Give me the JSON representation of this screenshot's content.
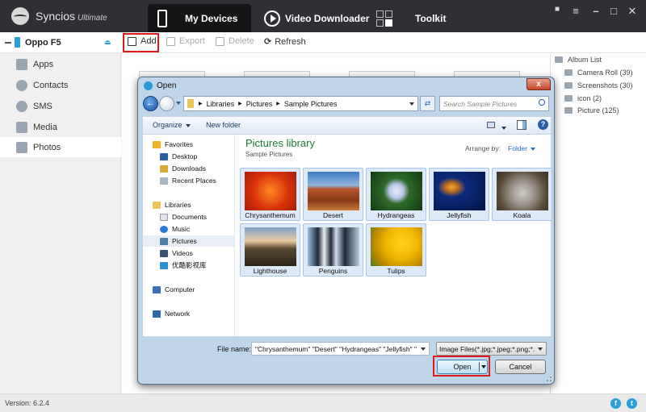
{
  "app": {
    "brand": "Syncios",
    "edition": "Ultimate",
    "nav_tabs": [
      {
        "label": "My Devices",
        "icon": "phone-icon",
        "active": true
      },
      {
        "label": "Video Downloader",
        "icon": "play-circle-icon",
        "active": false
      },
      {
        "label": "Toolkit",
        "icon": "grid-icon",
        "active": false
      }
    ],
    "window_controls": [
      "feedback-icon",
      "menu-icon",
      "minimize-icon",
      "maximize-icon",
      "close-icon"
    ]
  },
  "toolbar": {
    "device_name": "Oppo F5",
    "buttons": [
      {
        "label": "Add",
        "enabled": true,
        "highlighted": true
      },
      {
        "label": "Export",
        "enabled": false
      },
      {
        "label": "Delete",
        "enabled": false
      },
      {
        "label": "Refresh",
        "enabled": true
      }
    ]
  },
  "sidebar": {
    "items": [
      {
        "label": "Apps",
        "icon": "apps-icon"
      },
      {
        "label": "Contacts",
        "icon": "contacts-icon"
      },
      {
        "label": "SMS",
        "icon": "sms-icon"
      },
      {
        "label": "Media",
        "icon": "media-icon"
      },
      {
        "label": "Photos",
        "icon": "photos-icon",
        "active": true
      }
    ]
  },
  "albums": {
    "header": "Album List",
    "items": [
      {
        "label": "Camera Roll (39)"
      },
      {
        "label": "Screenshots (30)"
      },
      {
        "label": "icon (2)"
      },
      {
        "label": "Picture (125)"
      }
    ]
  },
  "footer": {
    "version": "Version: 6.2.4",
    "social": [
      "f",
      "t"
    ]
  },
  "dialog": {
    "title": "Open",
    "close": "x",
    "breadcrumbs": [
      "Libraries",
      "Pictures",
      "Sample Pictures"
    ],
    "search_placeholder": "Search Sample Pictures",
    "organize": "Organize",
    "new_folder": "New folder",
    "tree": {
      "favorites_header": "Favorites",
      "favorites": [
        "Desktop",
        "Downloads",
        "Recent Places"
      ],
      "libraries_header": "Libraries",
      "libraries": [
        "Documents",
        "Music",
        "Pictures",
        "Videos",
        "优酷影视库"
      ],
      "selected": "Pictures",
      "computer": "Computer",
      "network": "Network"
    },
    "library_title": "Pictures library",
    "library_subtitle": "Sample Pictures",
    "arrange_label": "Arrange by:",
    "arrange_value": "Folder",
    "files": [
      {
        "name": "Chrysanthemum",
        "selected": true
      },
      {
        "name": "Desert",
        "selected": true
      },
      {
        "name": "Hydrangeas",
        "selected": true
      },
      {
        "name": "Jellyfish",
        "selected": true
      },
      {
        "name": "Koala",
        "selected": true
      },
      {
        "name": "Lighthouse",
        "selected": true
      },
      {
        "name": "Penguins",
        "selected": true
      },
      {
        "name": "Tulips",
        "selected": true
      }
    ],
    "file_name_label": "File name:",
    "file_name_value": "\"Chrysanthemum\" \"Desert\" \"Hydrangeas\" \"Jellyfish\" \"",
    "file_type": "Image Files(*.jpg;*.jpeg;*.png;*.",
    "open_label": "Open",
    "cancel_label": "Cancel"
  },
  "colors": {
    "accent": "#2aa0d8",
    "highlight": "#e0191b",
    "titlebar": "#2e3033"
  }
}
